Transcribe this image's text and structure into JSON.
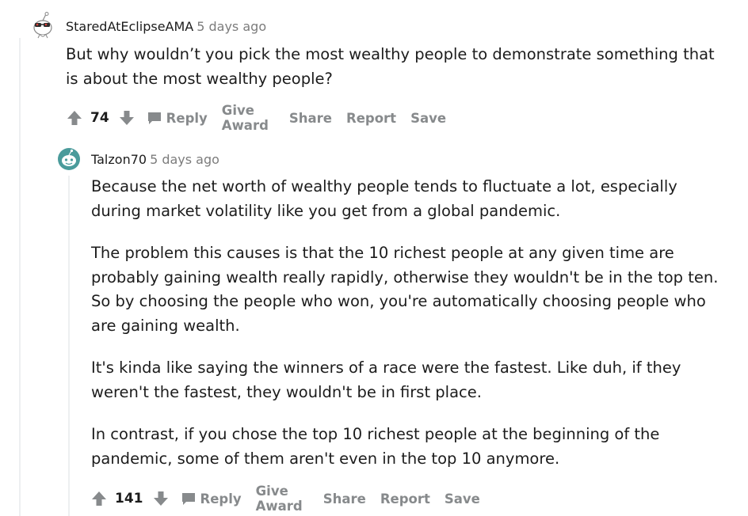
{
  "comments": [
    {
      "author": "StaredAtEclipseAMA",
      "time": "5 days ago",
      "paragraphs": [
        "But why wouldn’t you pick the most wealthy people to demonstrate something that is about the most wealthy people?"
      ],
      "votes": "74",
      "actions": {
        "reply": "Reply",
        "award": "Give Award",
        "share": "Share",
        "report": "Report",
        "save": "Save"
      }
    },
    {
      "author": "Talzon70",
      "time": "5 days ago",
      "paragraphs": [
        "Because the net worth of wealthy people tends to fluctuate a lot, especially during market volatility like you get from a global pandemic.",
        "The problem this causes is that the 10 richest people at any given time are probably gaining wealth really rapidly, otherwise they wouldn't be in the top ten. So by choosing the people who won, you're automatically choosing people who are gaining wealth.",
        "It's kinda like saying the winners of a race were the fastest. Like duh, if they weren't the fastest, they wouldn't be in first place.",
        "In contrast, if you chose the top 10 richest people at the beginning of the pandemic, some of them aren't even in the top 10 anymore."
      ],
      "votes": "141",
      "actions": {
        "reply": "Reply",
        "award": "Give Award",
        "share": "Share",
        "report": "Report",
        "save": "Save"
      }
    }
  ],
  "icons": {
    "upvote": "upvote-arrow-icon",
    "downvote": "downvote-arrow-icon",
    "reply": "speech-bubble-icon"
  },
  "colors": {
    "icon_gray": "#878a8c",
    "avatar_teal": "#4a9b9b",
    "thread_line": "#edeff1"
  }
}
